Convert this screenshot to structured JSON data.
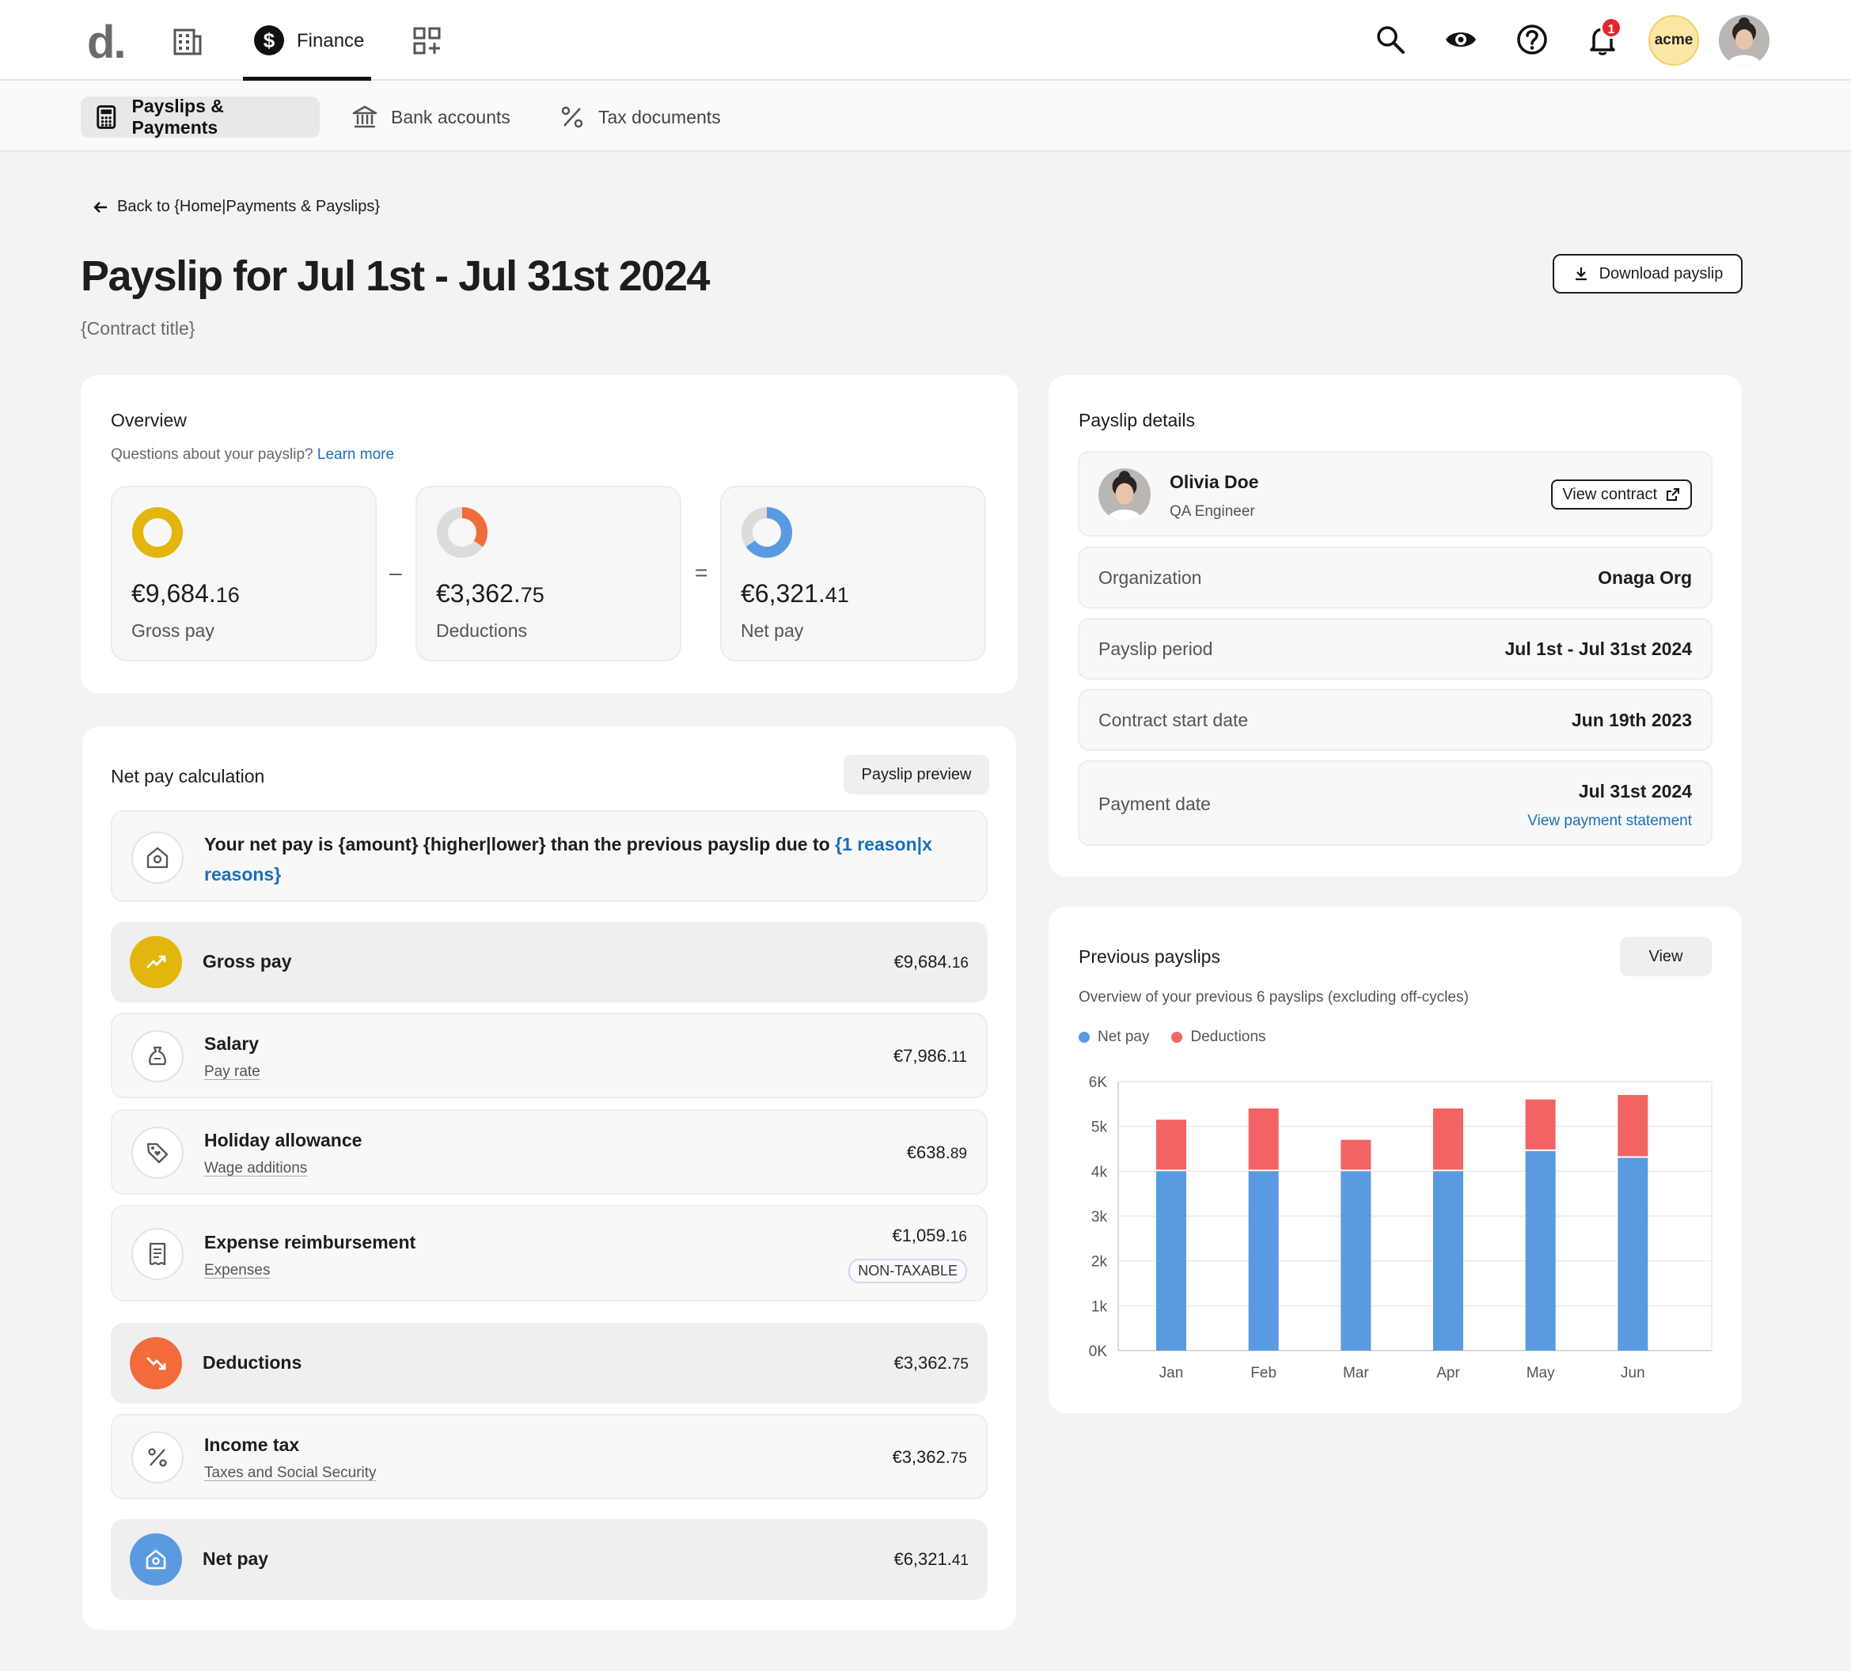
{
  "topbar": {
    "brand": "d.",
    "finance_label": "Finance",
    "notification_count": "1",
    "company_badge": "acme"
  },
  "subnav": {
    "tabs": [
      {
        "label": "Payslips & Payments",
        "icon": "calculator-icon",
        "active": true
      },
      {
        "label": "Bank accounts",
        "icon": "bank-icon",
        "active": false
      },
      {
        "label": "Tax documents",
        "icon": "percent-icon",
        "active": false
      }
    ]
  },
  "header": {
    "back_label": "Back to {Home|Payments & Payslips}",
    "title": "Payslip for Jul 1st - Jul 31st 2024",
    "contract_title": "{Contract title}",
    "download_label": "Download payslip"
  },
  "overview": {
    "title": "Overview",
    "help_text": "Questions about your payslip?",
    "help_link": "Learn more",
    "minus": "–",
    "equals": "=",
    "gross": {
      "amount_main": "€9,684.",
      "amount_cents": "16",
      "label": "Gross pay",
      "share": 1.0,
      "color": "#e2b60c"
    },
    "deductions": {
      "amount_main": "€3,362.",
      "amount_cents": "75",
      "label": "Deductions",
      "share": 0.347,
      "color": "#f26b3a"
    },
    "net": {
      "amount_main": "€6,321.",
      "amount_cents": "41",
      "label": "Net pay",
      "share": 0.653,
      "color": "#5a9ae0"
    }
  },
  "net_calc": {
    "title": "Net pay calculation",
    "preview_button": "Payslip preview",
    "notice_text": "Your net pay is {amount} {higher|lower} than the previous payslip due to ",
    "notice_link": "{1 reason|x reasons}",
    "rows": {
      "gross": {
        "name": "Gross pay",
        "amount_main": "€9,684.",
        "amount_cents": "16"
      },
      "salary": {
        "name": "Salary",
        "sub": "Pay rate",
        "amount_main": "€7,986.",
        "amount_cents": "11"
      },
      "holiday": {
        "name": "Holiday allowance",
        "sub": "Wage additions",
        "amount_main": "€638.",
        "amount_cents": "89"
      },
      "expense": {
        "name": "Expense reimbursement",
        "sub": "Expenses",
        "amount_main": "€1,059.",
        "amount_cents": "16",
        "tag": "NON-TAXABLE"
      },
      "deductions": {
        "name": "Deductions",
        "amount_main": "€3,362.",
        "amount_cents": "75"
      },
      "income_tax": {
        "name": "Income tax",
        "sub": "Taxes and Social Security",
        "amount_main": "€3,362.",
        "amount_cents": "75"
      },
      "net": {
        "name": "Net pay",
        "amount_main": "€6,321.",
        "amount_cents": "41"
      }
    }
  },
  "details": {
    "title": "Payslip details",
    "employee_name": "Olivia Doe",
    "employee_role": "QA Engineer",
    "view_contract": "View contract",
    "organization_key": "Organization",
    "organization_val": "Onaga Org",
    "period_key": "Payslip period",
    "period_val": "Jul 1st - Jul 31st 2024",
    "start_key": "Contract start date",
    "start_val": "Jun 19th 2023",
    "payment_key": "Payment date",
    "payment_val": "Jul 31st 2024",
    "payment_link": "View payment statement"
  },
  "previous": {
    "title": "Previous payslips",
    "view_button": "View",
    "subtitle": "Overview of your previous 6 payslips (excluding off-cycles)"
  },
  "chart_data": {
    "type": "bar",
    "stacked": true,
    "categories": [
      "Jan",
      "Feb",
      "Mar",
      "Apr",
      "May",
      "Jun"
    ],
    "series": [
      {
        "name": "Net pay",
        "color": "#5a9ae0",
        "values": [
          4000,
          4000,
          4000,
          4000,
          4450,
          4300
        ]
      },
      {
        "name": "Deductions",
        "color": "#f26464",
        "values": [
          1150,
          1400,
          700,
          1400,
          1150,
          1400
        ]
      }
    ],
    "yticks": [
      "0K",
      "1k",
      "2k",
      "3k",
      "4k",
      "5k",
      "6K"
    ],
    "ylim": [
      0,
      6000
    ],
    "grid": true,
    "legend": "top-left"
  }
}
